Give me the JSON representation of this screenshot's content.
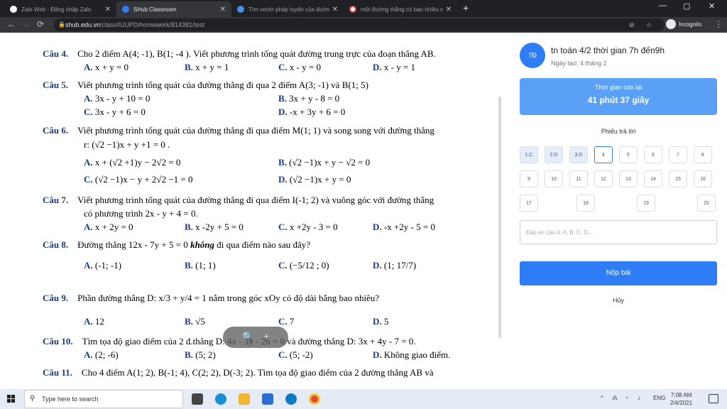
{
  "browser": {
    "tabs": [
      {
        "title": "Zalo Web - Đăng nhập Zalo",
        "active": false
      },
      {
        "title": "SHub Classroom",
        "active": true
      },
      {
        "title": "Tìm vectơ pháp tuyến của đường...",
        "active": false
      },
      {
        "title": "một đường thẳng có bao nhiêu v...",
        "active": false
      }
    ],
    "url_host": "shub.edu.vn",
    "url_path": "/class/IUUPD/homework/814381/test",
    "incognito_label": "Incognito"
  },
  "questions": [
    {
      "label": "Câu 4.",
      "text": "Cho 2 điểm A(4; -1), B(1; -4 ). Viết phương trình tổng quát đường trung trực của đoạn thẳng AB.",
      "options": [
        "A. x + y = 0",
        "B. x + y = 1",
        "C. x - y = 0",
        "D. x - y = 1"
      ]
    },
    {
      "label": "Câu 5.",
      "text": "Viết phương trình tổng quát của đường thẳng đi qua 2 điểm A(3; -1) và B(1; 5)",
      "options": [
        "A. 3x - y + 10 = 0",
        "B. 3x + y - 8 = 0",
        "C. 3x - y + 6 = 0",
        "D. -x + 3y + 6 = 0"
      ]
    },
    {
      "label": "Câu 6.",
      "text": "Viết phương trình tổng quát của đường thẳng đi qua điểm M(1; 1) và song song với đường thẳng",
      "text2": "r: (√2 −1)x + y +1 = 0 .",
      "options": [
        "A. x + (√2 +1)y − 2√2 = 0",
        "B. (√2 −1)x + y − √2 = 0",
        "C. (√2 −1)x − y + 2√2 −1 = 0",
        "D. (√2 −1)x + y = 0"
      ]
    },
    {
      "label": "Câu 7.",
      "text": "Viết phương trình tổng quát của đường thẳng đi qua điểm I(-1; 2) và vuông góc với đường thẳng",
      "text2": "có phương trình 2x - y + 4 = 0.",
      "options": [
        "A. x + 2y = 0",
        "B. x -2y + 5 = 0",
        "C. x +2y - 3 = 0",
        "D. -x +2y - 5 = 0"
      ]
    },
    {
      "label": "Câu 8.",
      "text_pre": "Đường thẳng 12x - 7y + 5 = 0 ",
      "text_emph": "không",
      "text_post": " đi qua điểm nào sau đây?",
      "options": [
        "A. (-1; -1)",
        "B. (1; 1)",
        "C. (−5/12 ; 0)",
        "D. (1; 17/7)"
      ]
    },
    {
      "label": "Câu 9.",
      "text": "Phần đường thẳng D: x/3 + y/4 = 1 nằm trong góc xOy có độ dài bằng bao nhiêu?",
      "options": [
        "A. 12",
        "B. √5",
        "C. 7",
        "D. 5"
      ]
    },
    {
      "label": "Câu 10.",
      "text": "Tìm tọa độ giao điểm của 2 đ.thẳng D: 4x - 3y - 26 = 0 và đường thẳng D: 3x + 4y - 7 = 0.",
      "options": [
        "A. (2; -6)",
        "B. (5; 2)",
        "C. (5; -2)",
        "D. Không giao điểm."
      ]
    },
    {
      "label": "Câu 11.",
      "text": "Cho 4 điểm A(1; 2), B(-1; 4), C(2; 2), D(-3; 2). Tìm tọa độ giao điểm của 2 đường thẳng AB và"
    }
  ],
  "panel": {
    "avatar": "7Đ",
    "title": "tn toán 4/2 thời gian 7h đến9h",
    "date": "Ngày tạo: 4 tháng 2",
    "timer_label": "Thời gian còn lại",
    "timer_value": "41 phút 37 giây",
    "sheet_title": "Phiếu trả lời",
    "cells": [
      "1:C",
      "2:D",
      "3:D",
      "4",
      "5",
      "6",
      "7",
      "8",
      "9",
      "10",
      "11",
      "12",
      "13",
      "14",
      "15",
      "16",
      "17",
      "18",
      "19",
      "20"
    ],
    "answer_placeholder": "Đáp án câu 4: A, B, C, D...",
    "submit_label": "Nộp bài",
    "cancel_label": "Hủy"
  },
  "zoom": {
    "minus": "🔍",
    "plus": "+"
  },
  "taskbar": {
    "search_placeholder": "Type here to search",
    "lang": "ENG",
    "time": "7:08 AM",
    "date": "2/4/2021"
  },
  "colors": {
    "accent": "#2e7df6",
    "timer": "#5aa0f6",
    "question_label": "#1a3a8a"
  }
}
